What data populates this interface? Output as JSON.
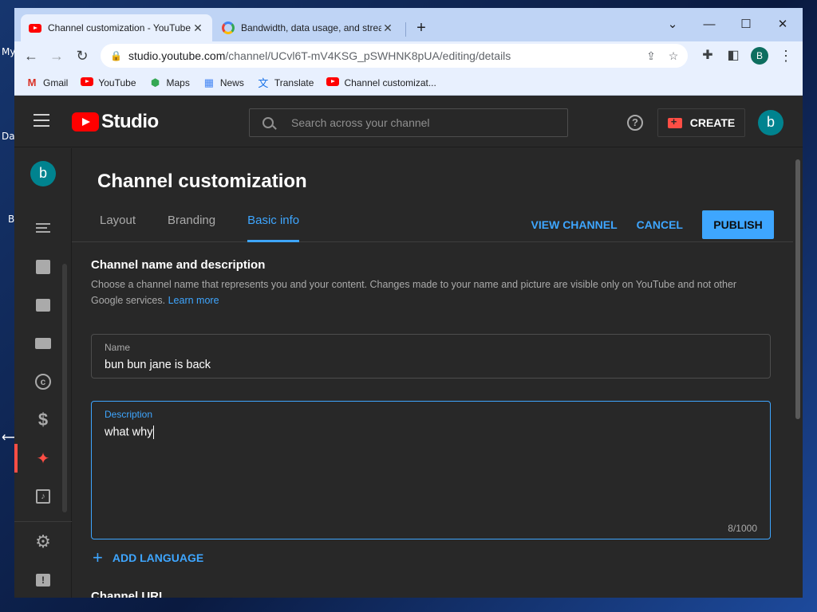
{
  "desktop": {
    "labels": [
      "My",
      "Da",
      "B"
    ]
  },
  "browser": {
    "tabs": [
      {
        "title": "Channel customization - YouTube Studio",
        "active": true
      },
      {
        "title": "Bandwidth, data usage, and streaming",
        "active": false
      }
    ],
    "url_host": "studio.youtube.com",
    "url_path": "/channel/UCvl6T-mV4KSG_pSWHNK8pUA/editing/details",
    "profile_initial": "B",
    "bookmarks": [
      "Gmail",
      "YouTube",
      "Maps",
      "News",
      "Translate",
      "Channel customizat..."
    ]
  },
  "studio": {
    "logo_text": "Studio",
    "search_placeholder": "Search across your channel",
    "create_label": "CREATE",
    "avatar_initial": "b",
    "help_glyph": "?"
  },
  "page": {
    "title": "Channel customization",
    "tabs": [
      "Layout",
      "Branding",
      "Basic info"
    ],
    "active_tab": "Basic info",
    "actions": {
      "view_channel": "VIEW CHANNEL",
      "cancel": "CANCEL",
      "publish": "PUBLISH"
    }
  },
  "form": {
    "section_title": "Channel name and description",
    "section_desc": "Choose a channel name that represents you and your content. Changes made to your name and picture are visible only on YouTube and not other Google services.",
    "learn_more": "Learn more",
    "name_label": "Name",
    "name_value": "bun bun jane is back",
    "desc_label": "Description",
    "desc_value": "what why",
    "desc_counter": "8/1000",
    "add_language": "ADD LANGUAGE",
    "next_section": "Channel URL"
  },
  "colors": {
    "accent": "#3ea6ff",
    "studio_bg": "#282828",
    "brand_red": "#ff0000"
  }
}
